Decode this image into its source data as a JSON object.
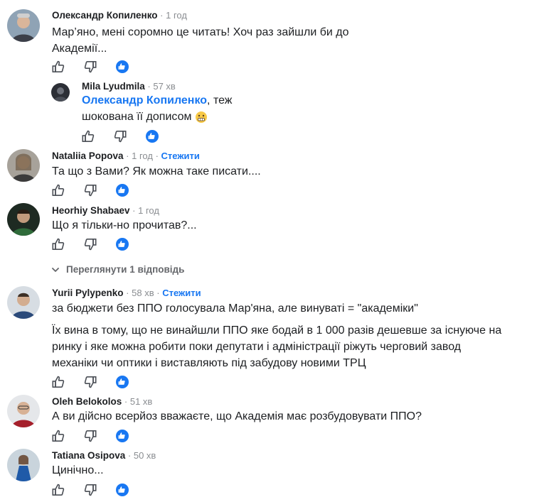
{
  "comments": [
    {
      "author": "Олександр Копиленко",
      "time": "1 год",
      "lines": [
        "Мар’яно, мені соромно це читать! Хоч раз зайшли би до",
        "Академії..."
      ]
    },
    {
      "author": "Mila Lyudmila",
      "time": "57 хв",
      "mention": "Олександр Копиленко",
      "lines": [
        ", теж",
        "шокована її дописом"
      ]
    },
    {
      "author": "Nataliia Popova",
      "time": "1 год",
      "follow": "Стежити",
      "lines": [
        "Та що з Вами? Як можна таке писати...."
      ]
    },
    {
      "author": "Heorhiy Shabaev",
      "time": "1 год",
      "lines": [
        "Що я тільки-но прочитав?..."
      ]
    },
    {
      "author": "Yurii Pylypenko",
      "time": "58 хв",
      "follow": "Стежити",
      "lines": [
        "за бюджети без ППО голосувала Мар'яна, але винуваті = \"академіки\"",
        "Їх вина в тому, що не винайшли ППО яке бодай в 1 000 разів дешевше за існуюче на",
        "ринку і яке можна робити поки депутати і адміністрації ріжуть черговий завод",
        "механіки чи оптики і виставляють під забудову новими ТРЦ"
      ]
    },
    {
      "author": "Oleh Belokolos",
      "time": "51 хв",
      "lines": [
        "А ви дійсно всерйоз вважаєте, що Академія має розбудовувати ППО?"
      ]
    },
    {
      "author": "Tatiana Osipova",
      "time": "50 хв",
      "lines": [
        "Цинічно..."
      ]
    }
  ],
  "view_replies": "Переглянути 1 відповідь",
  "icons": {
    "like": "thumb-up-icon",
    "dislike": "thumb-down-icon",
    "reaction": "like-reaction-icon",
    "emoji": "grimace-emoji-icon",
    "chevron": "chevron-down-icon"
  },
  "colors": {
    "link": "#1877f2",
    "muted": "#65676b",
    "reaction": "#1877f2"
  }
}
